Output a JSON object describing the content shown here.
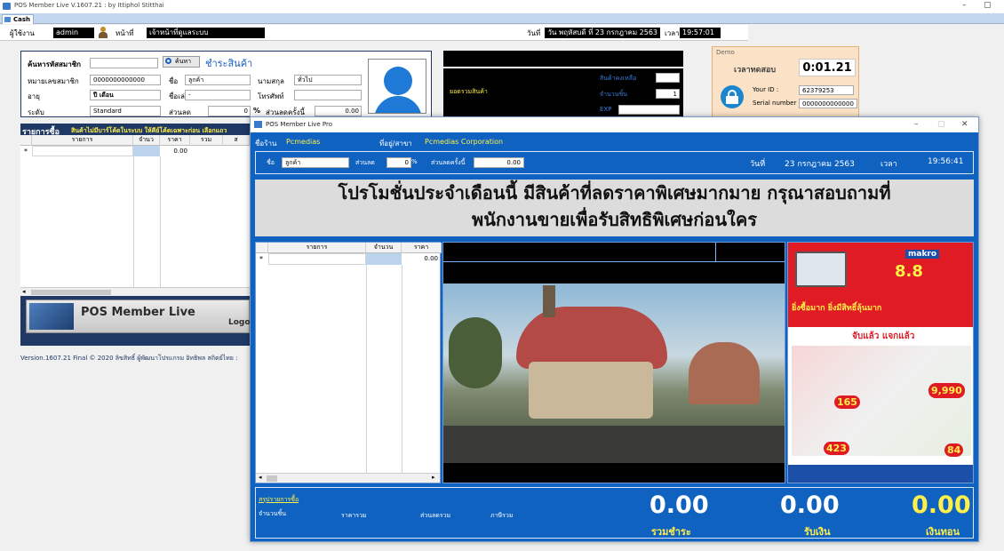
{
  "window": {
    "title": "POS Member Live V.1607.21 : by Ittiphol Stitthai",
    "tab": "Cash"
  },
  "topbar": {
    "user_label": "ผู้ใช้งาน",
    "user_value": "admin",
    "role_label": "หน้าที่",
    "role_value": "เจ้าหน้าที่ดูแลระบบ",
    "date_label": "วันที่",
    "date_value": "วัน พฤหัสบดี ที่ 23 กรกฎาคม 2563",
    "time_label": "เวลา",
    "time_value": "19:57:01"
  },
  "member_form": {
    "search_label": "ค้นหารหัสสมาชิก",
    "search_button": "ค้นหา",
    "pay_link": "ชำระสินค้า",
    "member_no_label": "หมายเลขสมาชิก",
    "member_no_value": "0000000000000",
    "name_label": "ชื่อ",
    "name_value": "ลูกค้า",
    "surname_label": "นามสกุล",
    "surname_value": "ทั่วไป",
    "age_label": "อายุ",
    "age_value": "ปี  เดือน",
    "nickname_label": "ชื่อเล่น",
    "nickname_value": "-",
    "phone_label": "โทรศัพท์",
    "level_label": "ระดับ",
    "level_value": "Standard",
    "discount_label": "ส่วนลด",
    "discount_value": "0",
    "percent": "%",
    "discount_per_label": "ส่วนลดครั้งนี้",
    "discount_per_value": "0.00"
  },
  "purchase_list": {
    "title": "รายการซื้อ",
    "notice": "สินค้าไม่มีบาร์โค้ดในระบบ ให้คีย์โค้ดเฉพาะก่อน เลือกแถว",
    "columns": [
      "รายการ",
      "จำนว",
      "ราคา",
      "รวม",
      "ส"
    ],
    "row_marker": "*",
    "row_value": "0.00"
  },
  "logo": {
    "text": "POS Member Live",
    "suffix": "Logo"
  },
  "version_text": "Version.1607.21 Final © 2020 ลิขสิทธิ์ ผู้พัฒนาโปรแกรม อิทธิพล สถิตย์ไทย :",
  "summary_panel": {
    "total_label": "ยอดรวมสินค้า",
    "remain_label": "สินค้าคงเหลือ",
    "qty_label": "จำนวนชิ้น",
    "qty_value": "1",
    "exp_label": "EXP"
  },
  "demo_panel": {
    "title": "Demo",
    "trial_label": "เวลาทดสอบ",
    "trial_value": "0:01.21",
    "your_id_label": "Your ID :",
    "your_id_value": "62379253",
    "serial_label": "Serial number",
    "serial_value": "0000000000000"
  },
  "pro": {
    "title": "POS Member Live Pro",
    "shop_label": "ชื่อร้าน",
    "shop_value": "Pcmedias",
    "address_label": "ที่อยู่/สาขา",
    "address_value": "Pcmedias Corporation",
    "name_label": "ชื่อ",
    "name_value": "ลูกค้า",
    "discount_label": "ส่วนลด",
    "discount_value": "0",
    "percent": "%",
    "discount_per_label": "ส่วนลดครั้งนี้",
    "discount_per_value": "0.00",
    "date_label": "วันที่",
    "date_value": "23 กรกฎาคม 2563",
    "time_label": "เวลา",
    "time_value": "19:56:41",
    "promo_line1": "โปรโมชั่นประจำเดือนนี้ มีสินค้าที่ลดราคาพิเศษมากมาย กรุณาสอบถามที่",
    "promo_line2": "พนักงานขายเพื่อรับสิทธิพิเศษก่อนใคร",
    "grid_columns": [
      "รายการ",
      "จำนวน",
      "ราคา"
    ],
    "grid_marker": "*",
    "grid_value": "0.00",
    "summary_link": "สรุปรายการซื้อ",
    "qty_label": "จำนวนชิ้น",
    "sum_label": "ราคารวม",
    "disc_sum_label": "ส่วนลดรวม",
    "tax_label": "ภาษีรวม",
    "total_pay": "0.00",
    "total_pay_label": "รวมชำระ",
    "received": "0.00",
    "received_label": "รับเงิน",
    "change": "0.00",
    "change_label": "เงินทอน"
  },
  "flyer": {
    "brand": "makro",
    "headline1": "ยิ่งซื้อมาก ยิ่งมีสิทธิ์ลุ้นมาก",
    "headline2": "จับแล้ว แจกแล้ว",
    "promo_88": "8.8",
    "price_9990": "9,990",
    "price_165": "165",
    "price_423": "423",
    "price_84": "84"
  },
  "colors": {
    "pro_blue": "#0f62c0",
    "navy": "#1f3864",
    "yellow": "#ffef4a",
    "link_blue": "#1d5fbf"
  }
}
